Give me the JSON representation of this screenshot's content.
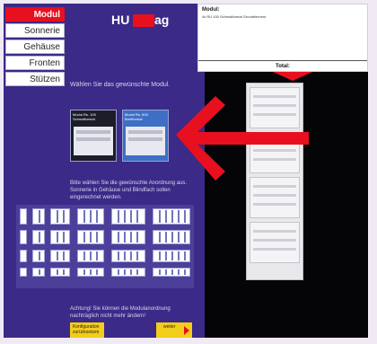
{
  "tabs": [
    {
      "label": "Modul",
      "active": true
    },
    {
      "label": "Sonnerie",
      "active": false
    },
    {
      "label": "Gehäuse",
      "active": false
    },
    {
      "label": "Fronten",
      "active": false
    },
    {
      "label": "Stützen",
      "active": false
    }
  ],
  "logo": {
    "left": "HU",
    "right": "ag"
  },
  "instructions": {
    "select_module": "Wählen Sie das gewünschte Modul.",
    "arrangement": "Bitte wählen Sie die gewünschte Anordnung aus. Sonnerie in Gehäuse und Blindfach sollen eingerechnet werden.",
    "warning": "Achtung! Sie können die Modulanordnung nachträglich nicht mehr ändern!"
  },
  "modules": [
    {
      "caption": "Modul Rs. 100 Schmalformat"
    },
    {
      "caption": "Modul Rs. 600 Breitformat"
    }
  ],
  "buttons": {
    "reset": "Konfiguration zurücksetzen",
    "next": "weiter"
  },
  "summary": {
    "modul_label": "Modul:",
    "modul_value": "4x RU 100 Schmalformat Grundelement",
    "total_label": "Total:"
  },
  "colors": {
    "panel": "#3b2a87",
    "accent": "#e8101f",
    "button": "#f2cd1a"
  }
}
